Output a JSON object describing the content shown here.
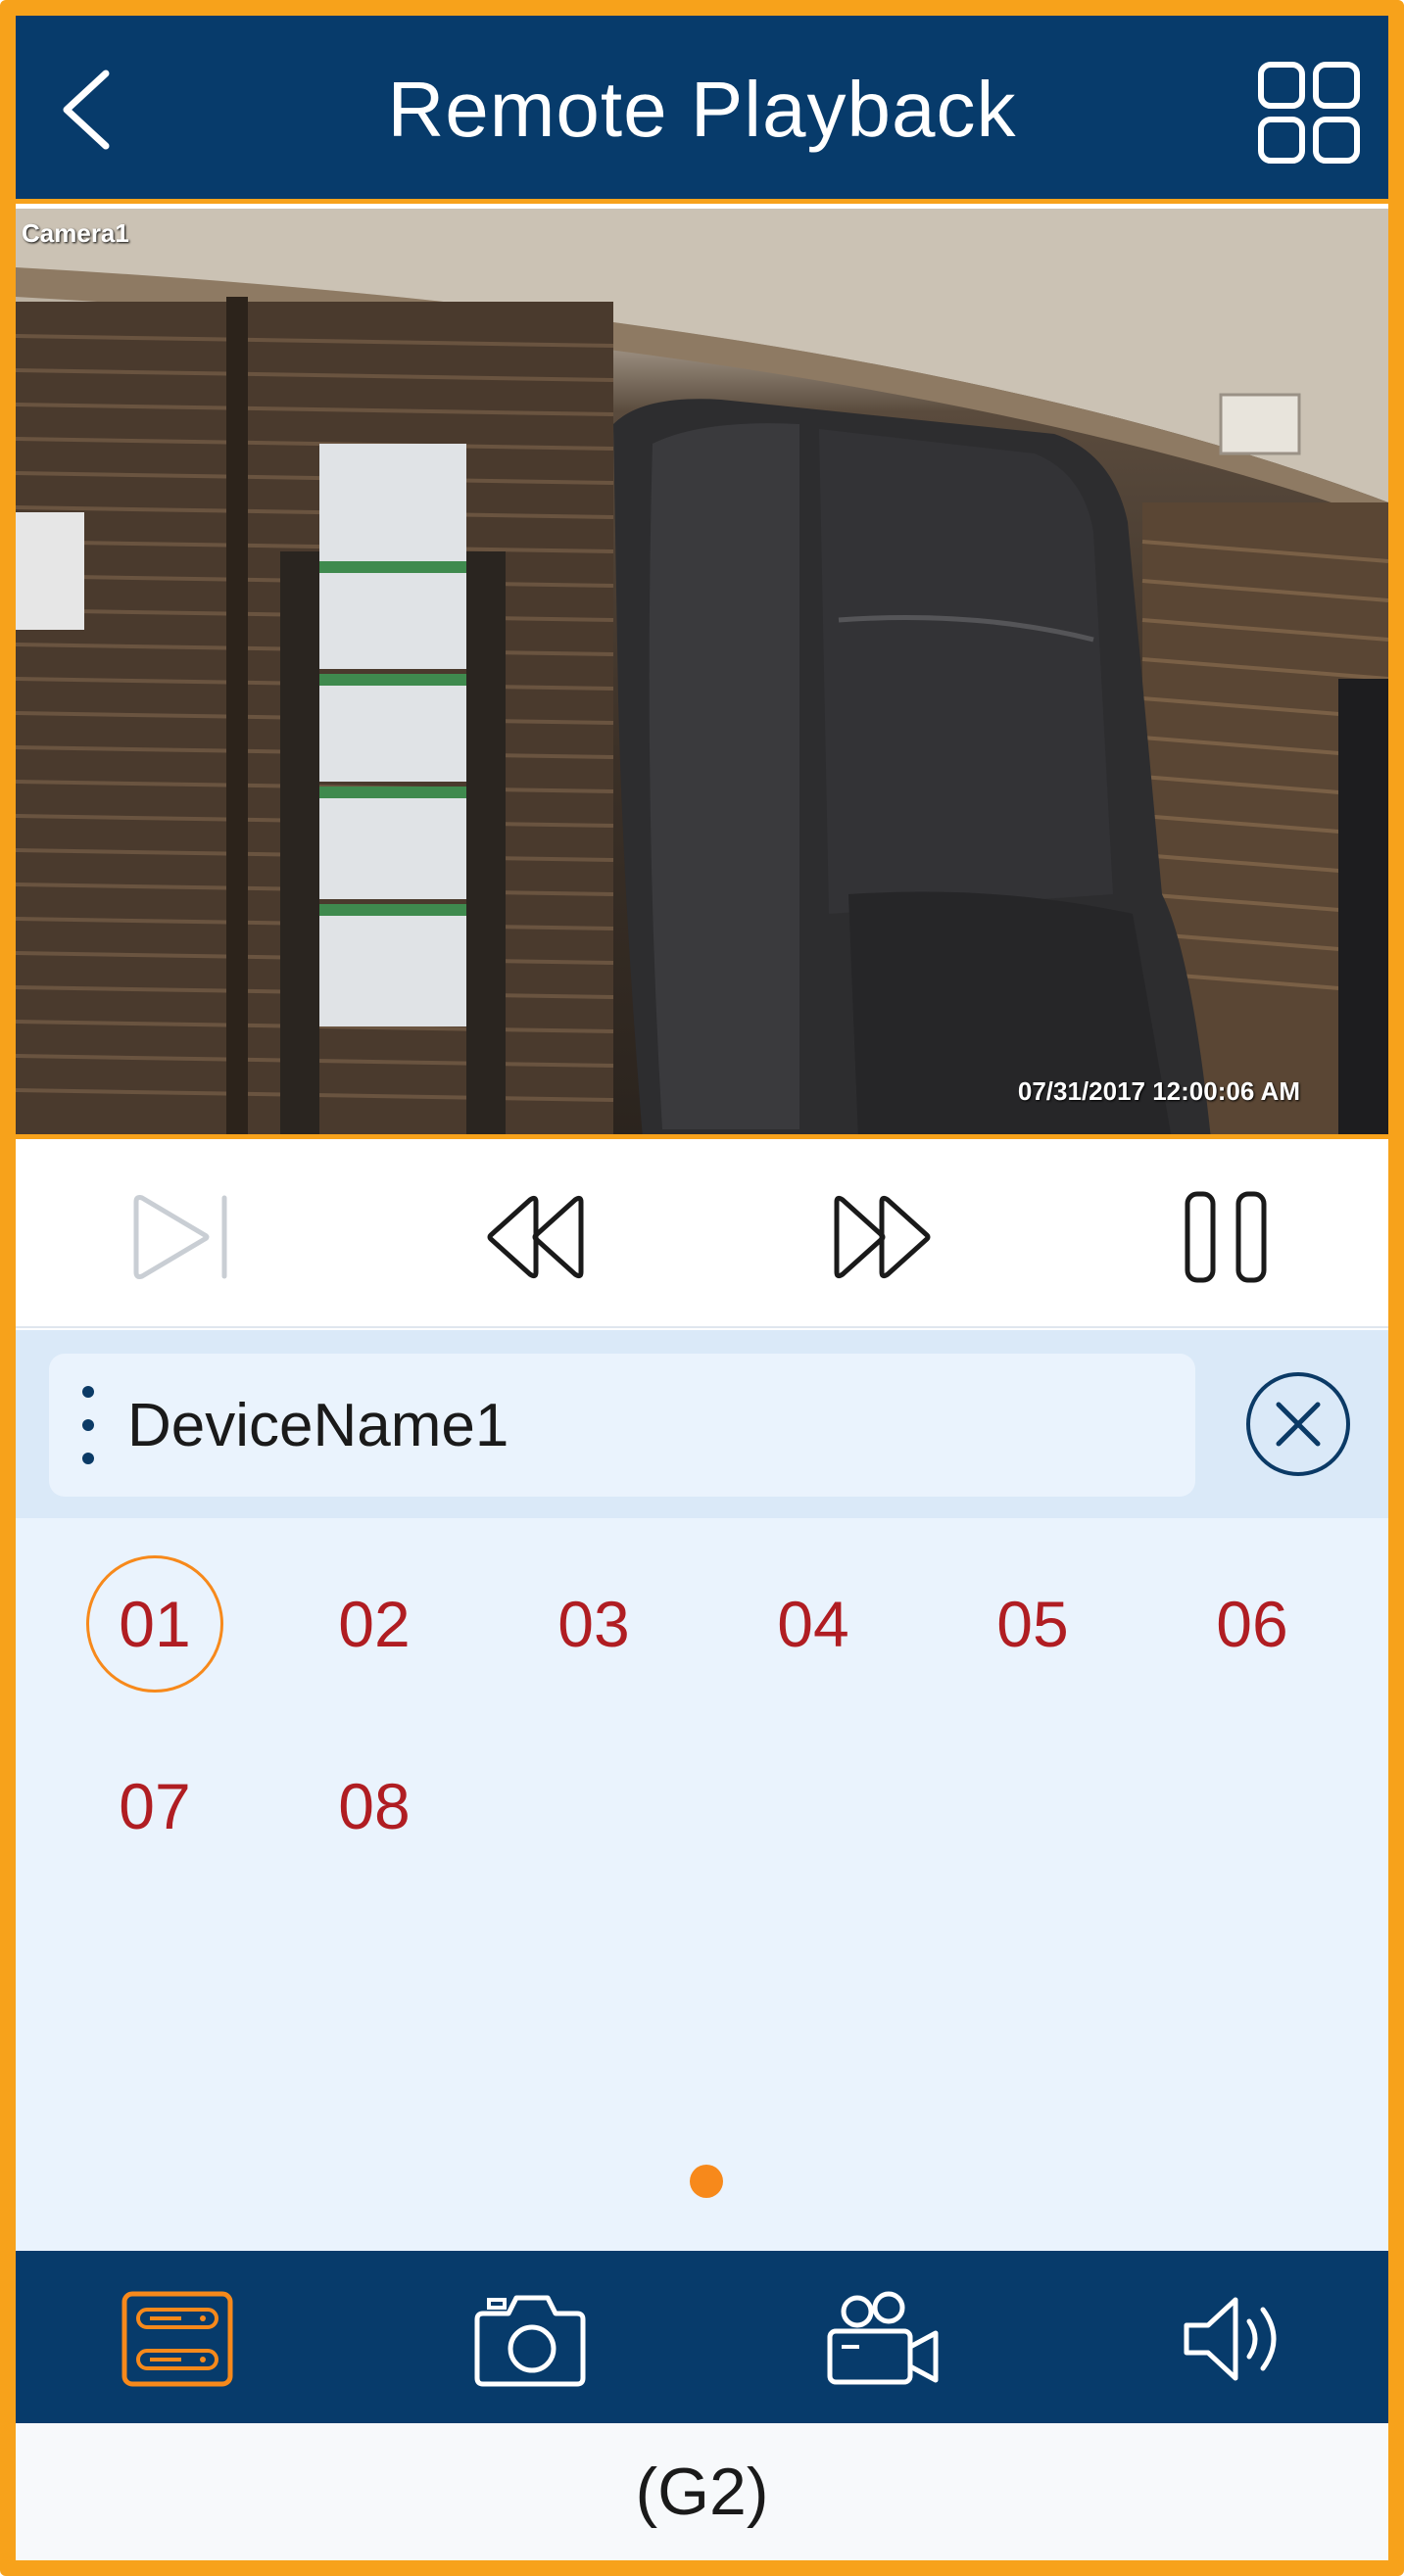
{
  "header": {
    "title": "Remote Playback",
    "back_icon": "chevron-left-icon",
    "layout_icon": "grid-four-icon"
  },
  "video": {
    "camera_label": "Camera1",
    "timestamp": "07/31/2017 12:00:06 AM"
  },
  "controls": [
    {
      "name": "step-forward-icon",
      "enabled": false
    },
    {
      "name": "rewind-icon",
      "enabled": true
    },
    {
      "name": "fast-forward-icon",
      "enabled": true
    },
    {
      "name": "pause-icon",
      "enabled": true
    }
  ],
  "device": {
    "name": "DeviceName1",
    "menu_icon": "vertical-dots-icon",
    "close_icon": "close-circle-icon"
  },
  "channels": [
    {
      "label": "01",
      "selected": true
    },
    {
      "label": "02",
      "selected": false
    },
    {
      "label": "03",
      "selected": false
    },
    {
      "label": "04",
      "selected": false
    },
    {
      "label": "05",
      "selected": false
    },
    {
      "label": "06",
      "selected": false
    },
    {
      "label": "07",
      "selected": false
    },
    {
      "label": "08",
      "selected": false
    }
  ],
  "pager": {
    "pages": 1,
    "current": 1
  },
  "toolbar": [
    {
      "name": "device-list-icon",
      "active": true
    },
    {
      "name": "camera-snapshot-icon",
      "active": false
    },
    {
      "name": "video-record-icon",
      "active": false
    },
    {
      "name": "speaker-icon",
      "active": false
    }
  ],
  "footer": {
    "label": "(G2)"
  },
  "colors": {
    "primary": "#073b6b",
    "accent": "#f7a21b",
    "channel_text": "#b01d22",
    "panel_bg": "#eaf3fd"
  }
}
